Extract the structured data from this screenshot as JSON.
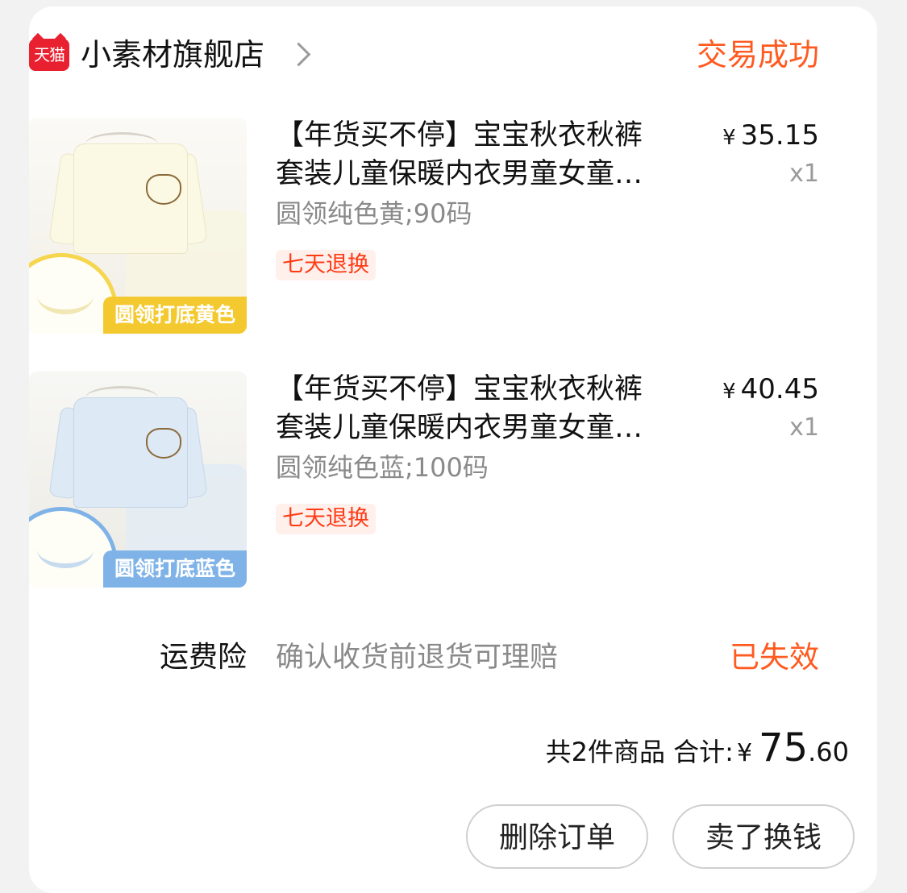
{
  "shop": {
    "logo_text": "天猫",
    "name": "小素材旗舰店",
    "status": "交易成功"
  },
  "items": [
    {
      "title": "【年货买不停】宝宝秋衣秋裤套装儿童保暖内衣男童女童…",
      "sku": "圆领纯色黄;90码",
      "tag": "七天退换",
      "price_symbol": "¥",
      "price": "35.15",
      "qty": "x1",
      "image_banner": "圆领打底黄色"
    },
    {
      "title": "【年货买不停】宝宝秋衣秋裤套装儿童保暖内衣男童女童…",
      "sku": "圆领纯色蓝;100码",
      "tag": "七天退换",
      "price_symbol": "¥",
      "price": "40.45",
      "qty": "x1",
      "image_banner": "圆领打底蓝色"
    }
  ],
  "insurance": {
    "label": "运费险",
    "description": "确认收货前退货可理赔",
    "status": "已失效"
  },
  "summary": {
    "count_text": "共2件商品",
    "total_label": "合计:",
    "symbol": "¥",
    "total_int": "75",
    "total_dec": ".60"
  },
  "actions": {
    "delete_label": "删除订单",
    "sell_label": "卖了换钱"
  },
  "colors": {
    "accent": "#ff5a1f",
    "tag_text": "#ff3b16",
    "tmall_red": "#e8202f"
  }
}
